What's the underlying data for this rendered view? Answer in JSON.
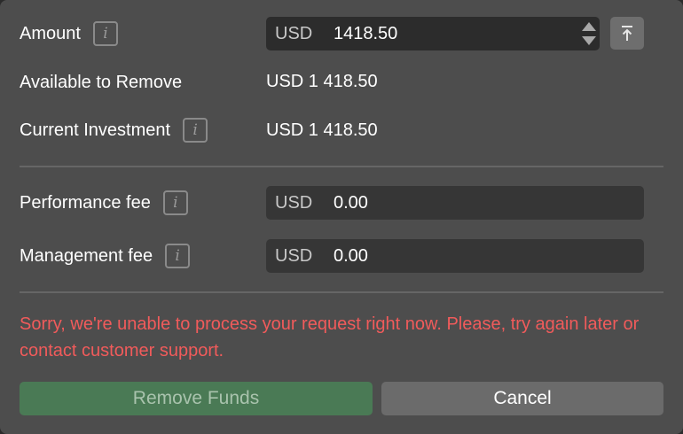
{
  "amount": {
    "label": "Amount",
    "currency": "USD",
    "value": "1418.50"
  },
  "available": {
    "label": "Available to Remove",
    "value": "USD 1 418.50"
  },
  "investment": {
    "label": "Current Investment",
    "value": "USD 1 418.50"
  },
  "performance_fee": {
    "label": "Performance fee",
    "currency": "USD",
    "value": "0.00"
  },
  "management_fee": {
    "label": "Management fee",
    "currency": "USD",
    "value": "0.00"
  },
  "info_icon_glyph": "i",
  "error_message": "Sorry, we're unable to process your request right now. Please, try again later or contact customer support.",
  "buttons": {
    "remove": "Remove Funds",
    "cancel": "Cancel"
  },
  "colors": {
    "error": "#f15b5b",
    "primary_button": "#4a7a55",
    "background": "#4d4d4d"
  }
}
